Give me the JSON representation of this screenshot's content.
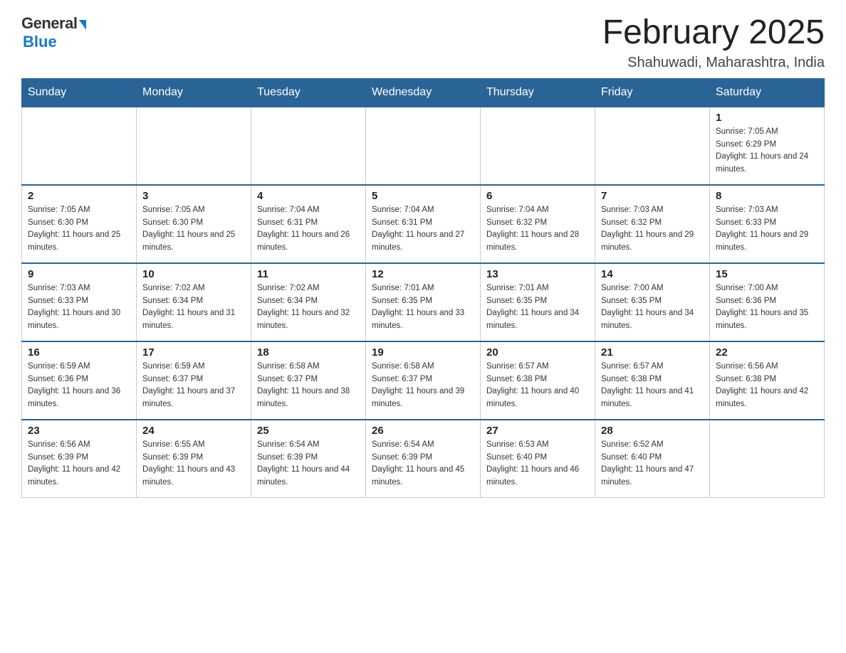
{
  "header": {
    "logo_general": "General",
    "logo_blue": "Blue",
    "month_title": "February 2025",
    "location": "Shahuwadi, Maharashtra, India"
  },
  "days_of_week": [
    "Sunday",
    "Monday",
    "Tuesday",
    "Wednesday",
    "Thursday",
    "Friday",
    "Saturday"
  ],
  "weeks": [
    [
      {
        "day": "",
        "sunrise": "",
        "sunset": "",
        "daylight": ""
      },
      {
        "day": "",
        "sunrise": "",
        "sunset": "",
        "daylight": ""
      },
      {
        "day": "",
        "sunrise": "",
        "sunset": "",
        "daylight": ""
      },
      {
        "day": "",
        "sunrise": "",
        "sunset": "",
        "daylight": ""
      },
      {
        "day": "",
        "sunrise": "",
        "sunset": "",
        "daylight": ""
      },
      {
        "day": "",
        "sunrise": "",
        "sunset": "",
        "daylight": ""
      },
      {
        "day": "1",
        "sunrise": "Sunrise: 7:05 AM",
        "sunset": "Sunset: 6:29 PM",
        "daylight": "Daylight: 11 hours and 24 minutes."
      }
    ],
    [
      {
        "day": "2",
        "sunrise": "Sunrise: 7:05 AM",
        "sunset": "Sunset: 6:30 PM",
        "daylight": "Daylight: 11 hours and 25 minutes."
      },
      {
        "day": "3",
        "sunrise": "Sunrise: 7:05 AM",
        "sunset": "Sunset: 6:30 PM",
        "daylight": "Daylight: 11 hours and 25 minutes."
      },
      {
        "day": "4",
        "sunrise": "Sunrise: 7:04 AM",
        "sunset": "Sunset: 6:31 PM",
        "daylight": "Daylight: 11 hours and 26 minutes."
      },
      {
        "day": "5",
        "sunrise": "Sunrise: 7:04 AM",
        "sunset": "Sunset: 6:31 PM",
        "daylight": "Daylight: 11 hours and 27 minutes."
      },
      {
        "day": "6",
        "sunrise": "Sunrise: 7:04 AM",
        "sunset": "Sunset: 6:32 PM",
        "daylight": "Daylight: 11 hours and 28 minutes."
      },
      {
        "day": "7",
        "sunrise": "Sunrise: 7:03 AM",
        "sunset": "Sunset: 6:32 PM",
        "daylight": "Daylight: 11 hours and 29 minutes."
      },
      {
        "day": "8",
        "sunrise": "Sunrise: 7:03 AM",
        "sunset": "Sunset: 6:33 PM",
        "daylight": "Daylight: 11 hours and 29 minutes."
      }
    ],
    [
      {
        "day": "9",
        "sunrise": "Sunrise: 7:03 AM",
        "sunset": "Sunset: 6:33 PM",
        "daylight": "Daylight: 11 hours and 30 minutes."
      },
      {
        "day": "10",
        "sunrise": "Sunrise: 7:02 AM",
        "sunset": "Sunset: 6:34 PM",
        "daylight": "Daylight: 11 hours and 31 minutes."
      },
      {
        "day": "11",
        "sunrise": "Sunrise: 7:02 AM",
        "sunset": "Sunset: 6:34 PM",
        "daylight": "Daylight: 11 hours and 32 minutes."
      },
      {
        "day": "12",
        "sunrise": "Sunrise: 7:01 AM",
        "sunset": "Sunset: 6:35 PM",
        "daylight": "Daylight: 11 hours and 33 minutes."
      },
      {
        "day": "13",
        "sunrise": "Sunrise: 7:01 AM",
        "sunset": "Sunset: 6:35 PM",
        "daylight": "Daylight: 11 hours and 34 minutes."
      },
      {
        "day": "14",
        "sunrise": "Sunrise: 7:00 AM",
        "sunset": "Sunset: 6:35 PM",
        "daylight": "Daylight: 11 hours and 34 minutes."
      },
      {
        "day": "15",
        "sunrise": "Sunrise: 7:00 AM",
        "sunset": "Sunset: 6:36 PM",
        "daylight": "Daylight: 11 hours and 35 minutes."
      }
    ],
    [
      {
        "day": "16",
        "sunrise": "Sunrise: 6:59 AM",
        "sunset": "Sunset: 6:36 PM",
        "daylight": "Daylight: 11 hours and 36 minutes."
      },
      {
        "day": "17",
        "sunrise": "Sunrise: 6:59 AM",
        "sunset": "Sunset: 6:37 PM",
        "daylight": "Daylight: 11 hours and 37 minutes."
      },
      {
        "day": "18",
        "sunrise": "Sunrise: 6:58 AM",
        "sunset": "Sunset: 6:37 PM",
        "daylight": "Daylight: 11 hours and 38 minutes."
      },
      {
        "day": "19",
        "sunrise": "Sunrise: 6:58 AM",
        "sunset": "Sunset: 6:37 PM",
        "daylight": "Daylight: 11 hours and 39 minutes."
      },
      {
        "day": "20",
        "sunrise": "Sunrise: 6:57 AM",
        "sunset": "Sunset: 6:38 PM",
        "daylight": "Daylight: 11 hours and 40 minutes."
      },
      {
        "day": "21",
        "sunrise": "Sunrise: 6:57 AM",
        "sunset": "Sunset: 6:38 PM",
        "daylight": "Daylight: 11 hours and 41 minutes."
      },
      {
        "day": "22",
        "sunrise": "Sunrise: 6:56 AM",
        "sunset": "Sunset: 6:38 PM",
        "daylight": "Daylight: 11 hours and 42 minutes."
      }
    ],
    [
      {
        "day": "23",
        "sunrise": "Sunrise: 6:56 AM",
        "sunset": "Sunset: 6:39 PM",
        "daylight": "Daylight: 11 hours and 42 minutes."
      },
      {
        "day": "24",
        "sunrise": "Sunrise: 6:55 AM",
        "sunset": "Sunset: 6:39 PM",
        "daylight": "Daylight: 11 hours and 43 minutes."
      },
      {
        "day": "25",
        "sunrise": "Sunrise: 6:54 AM",
        "sunset": "Sunset: 6:39 PM",
        "daylight": "Daylight: 11 hours and 44 minutes."
      },
      {
        "day": "26",
        "sunrise": "Sunrise: 6:54 AM",
        "sunset": "Sunset: 6:39 PM",
        "daylight": "Daylight: 11 hours and 45 minutes."
      },
      {
        "day": "27",
        "sunrise": "Sunrise: 6:53 AM",
        "sunset": "Sunset: 6:40 PM",
        "daylight": "Daylight: 11 hours and 46 minutes."
      },
      {
        "day": "28",
        "sunrise": "Sunrise: 6:52 AM",
        "sunset": "Sunset: 6:40 PM",
        "daylight": "Daylight: 11 hours and 47 minutes."
      },
      {
        "day": "",
        "sunrise": "",
        "sunset": "",
        "daylight": ""
      }
    ]
  ]
}
